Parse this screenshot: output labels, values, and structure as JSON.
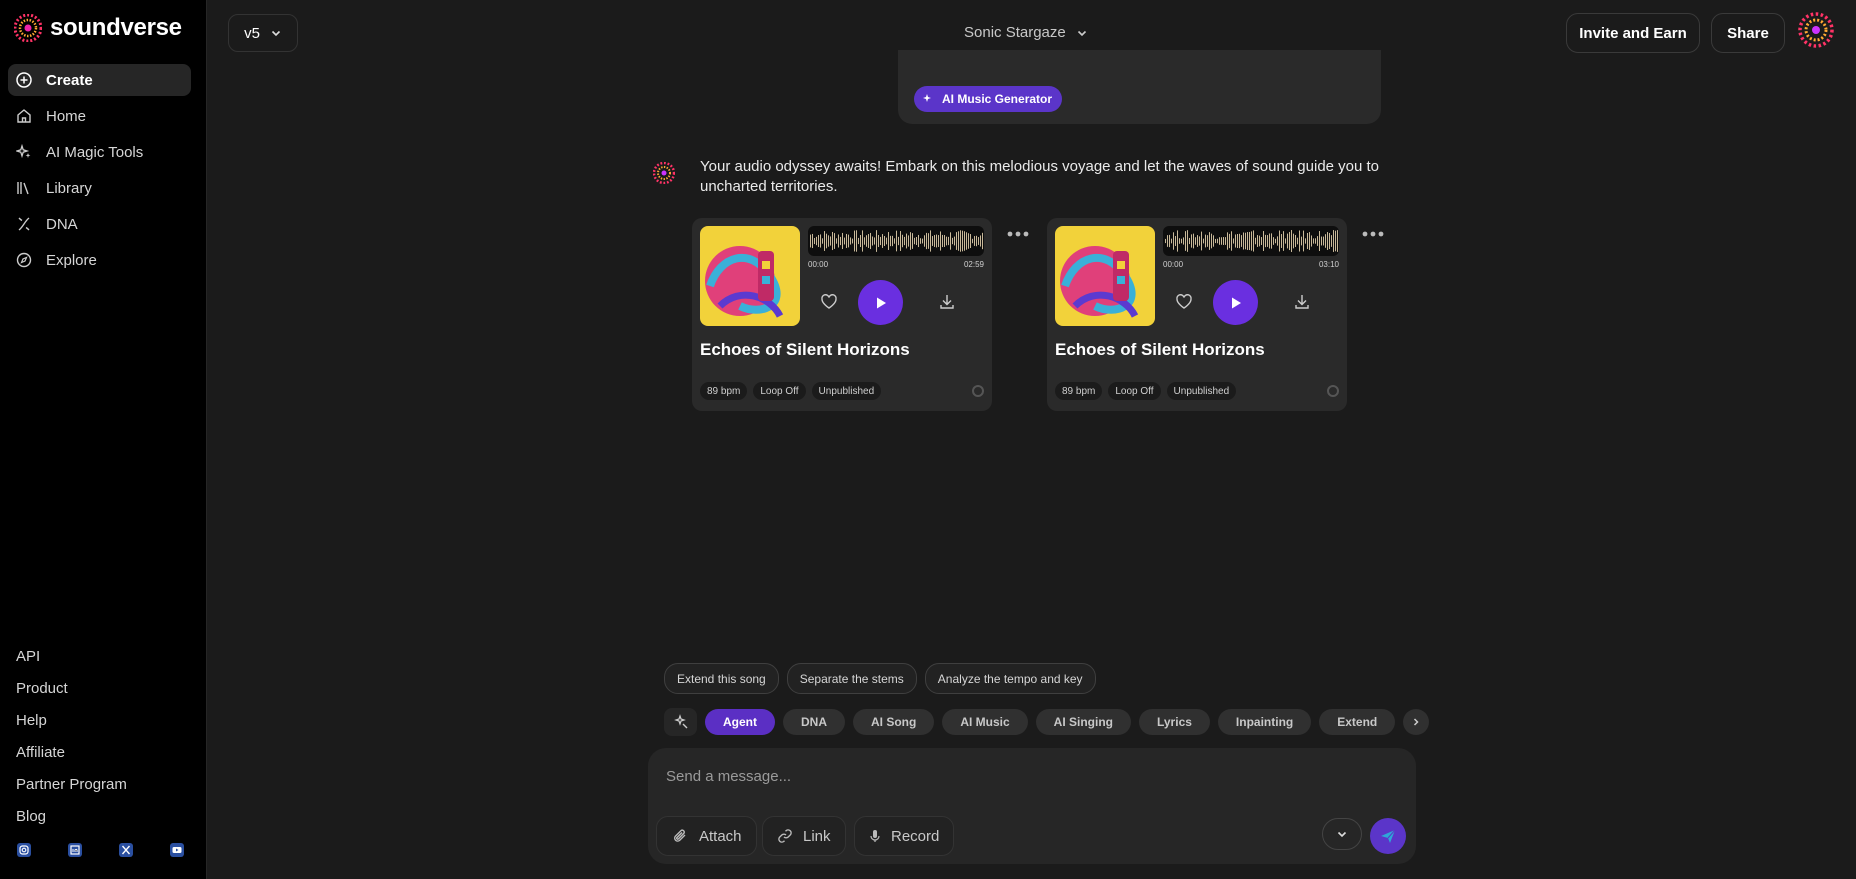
{
  "app": {
    "brand": "soundverse"
  },
  "sidebar": {
    "items": [
      {
        "label": "Create",
        "icon": "plus-circle-icon"
      },
      {
        "label": "Home",
        "icon": "home-icon"
      },
      {
        "label": "AI Magic Tools",
        "icon": "sparkles-icon"
      },
      {
        "label": "Library",
        "icon": "library-icon"
      },
      {
        "label": "DNA",
        "icon": "dna-icon"
      },
      {
        "label": "Explore",
        "icon": "compass-icon"
      }
    ],
    "links": [
      "API",
      "Product",
      "Help",
      "Affiliate",
      "Partner Program",
      "Blog"
    ],
    "socials": [
      "instagram-icon",
      "linkedin-icon",
      "x-icon",
      "youtube-icon"
    ]
  },
  "header": {
    "version": "v5",
    "project_title": "Sonic Stargaze",
    "invite_label": "Invite and Earn",
    "share_label": "Share"
  },
  "prior_message": {
    "tool_chip": "AI Music Generator"
  },
  "response": {
    "text": "Your audio odyssey awaits! Embark on this melodious voyage and let the waves of sound guide you to uncharted territories.",
    "songs": [
      {
        "title": "Echoes of Silent Horizons",
        "time_start": "00:00",
        "time_end": "02:59",
        "tags": [
          "89 bpm",
          "Loop Off",
          "Unpublished"
        ]
      },
      {
        "title": "Echoes of Silent Horizons",
        "time_start": "00:00",
        "time_end": "03:10",
        "tags": [
          "89 bpm",
          "Loop Off",
          "Unpublished"
        ]
      }
    ]
  },
  "composer": {
    "suggestions": [
      "Extend this song",
      "Separate the stems",
      "Analyze the tempo and key"
    ],
    "modes": [
      "Agent",
      "DNA",
      "AI Song",
      "AI Music",
      "AI Singing",
      "Lyrics",
      "Inpainting",
      "Extend"
    ],
    "active_mode": "Agent",
    "placeholder": "Send a message...",
    "attach_label": "Attach",
    "link_label": "Link",
    "record_label": "Record"
  },
  "colors": {
    "accent": "#5b35c9",
    "play": "#6a2fe0",
    "background": "#1b1b1b"
  }
}
